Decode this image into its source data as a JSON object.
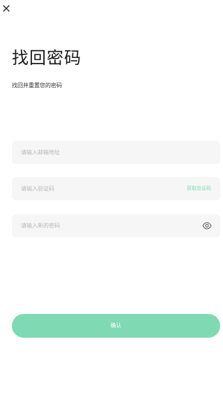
{
  "header": {
    "close_icon": "close-icon"
  },
  "page": {
    "title": "找回密码",
    "subtitle": "找回并重置您的密码"
  },
  "form": {
    "email": {
      "value": "",
      "placeholder": "请输入邮箱地址"
    },
    "code": {
      "value": "",
      "placeholder": "请输入验证码",
      "get_code_label": "获取验证码"
    },
    "password": {
      "value": "",
      "placeholder": "请输入新的密码",
      "visibility_icon": "eye-icon"
    },
    "confirm_label": "确认"
  },
  "colors": {
    "accent": "#7fd9b3",
    "field_bg": "#f6f6f6",
    "placeholder": "#b8b8b8",
    "title": "#1a1a1a"
  }
}
